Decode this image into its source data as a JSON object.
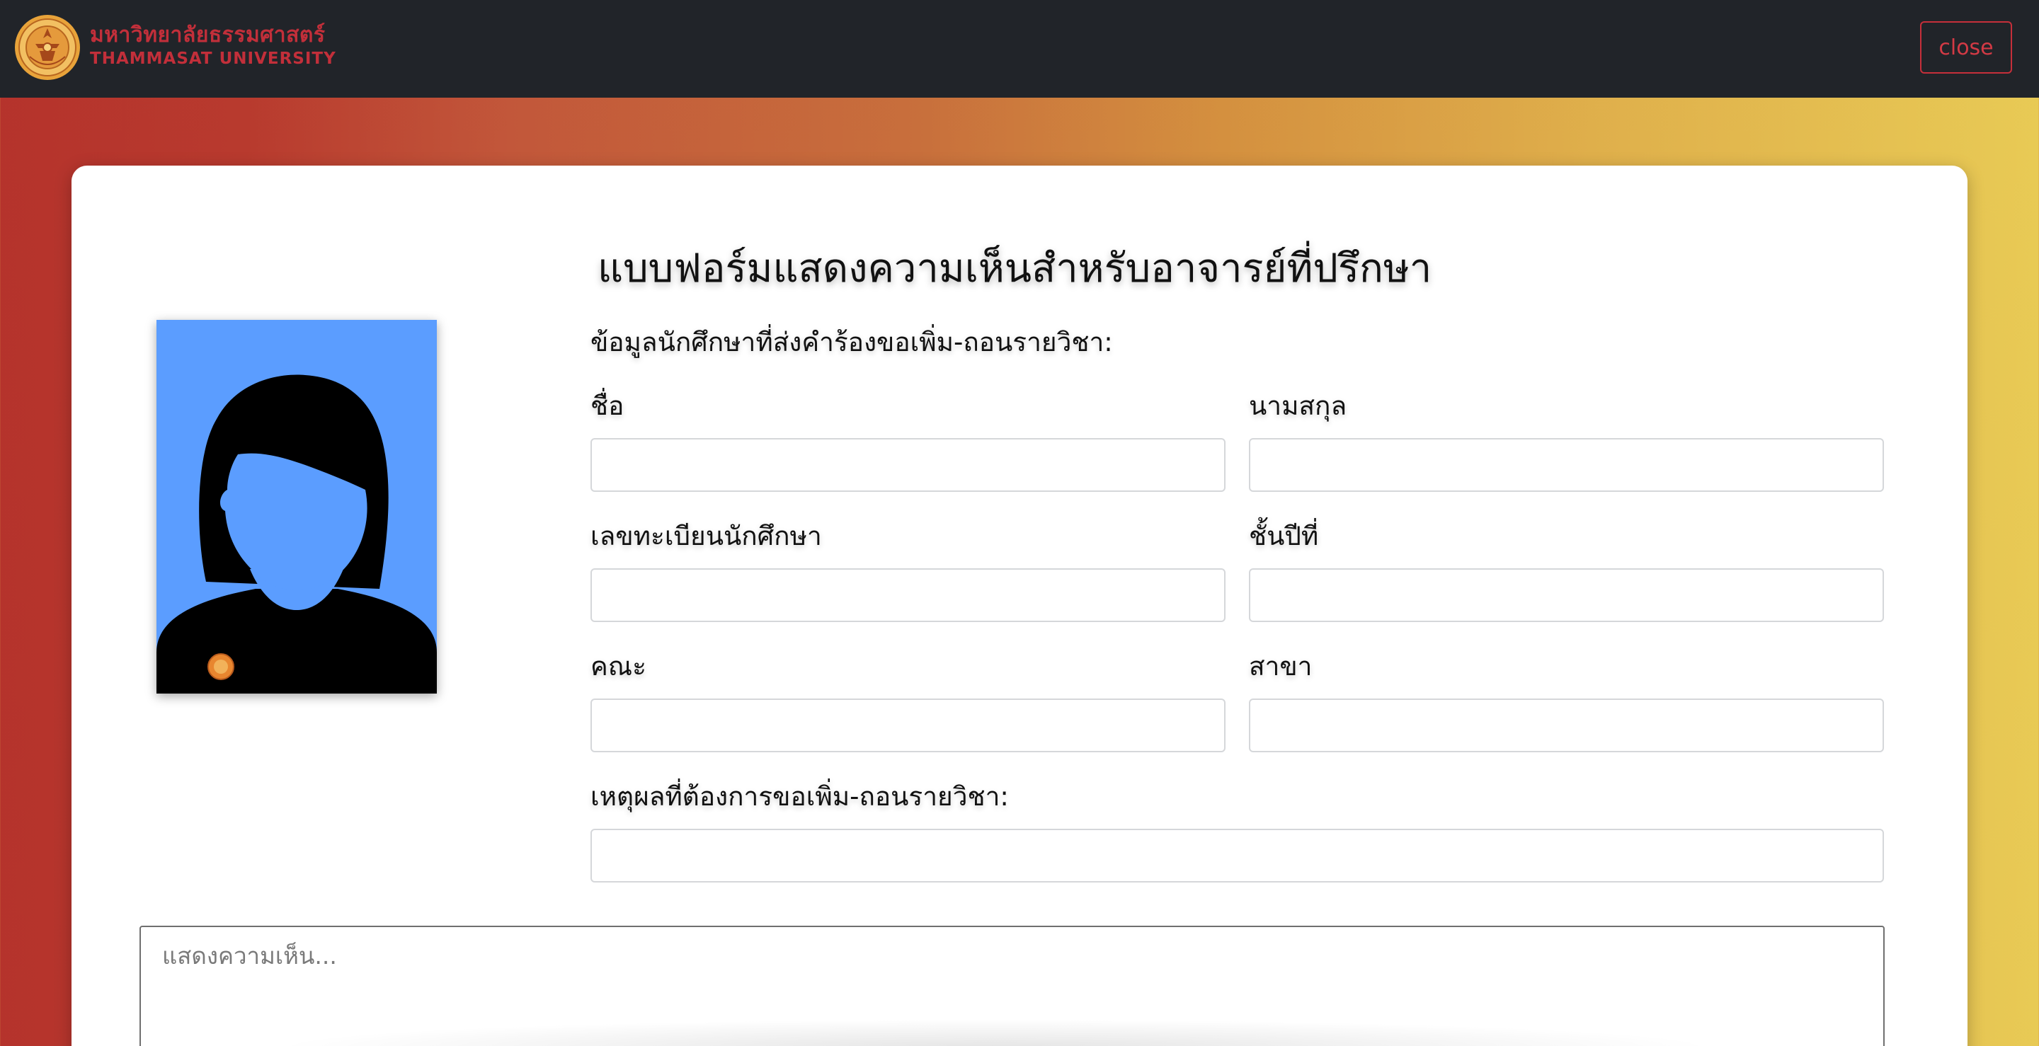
{
  "header": {
    "brand_th": "มหาวิทยาลัยธรรมศาสตร์",
    "brand_en": "THAMMASAT UNIVERSITY",
    "close_label": "close"
  },
  "form": {
    "title": "แบบฟอร์มแสดงความเห็นสำหรับอาจารย์ที่ปรึกษา",
    "subtitle": "ข้อมูลนักศึกษาที่ส่งคำร้องขอเพิ่ม-ถอนรายวิชา:",
    "first_name_label": "ชื่อ",
    "last_name_label": "นามสกุล",
    "student_id_label": "เลขทะเบียนนักศึกษา",
    "year_label": "ชั้นปีที่",
    "faculty_label": "คณะ",
    "major_label": "สาขา",
    "reason_label": "เหตุผลที่ต้องการขอเพิ่ม-ถอนรายวิชา:",
    "first_name_value": "",
    "last_name_value": "",
    "student_id_value": "",
    "year_value": "",
    "faculty_value": "",
    "major_value": "",
    "reason_value": "",
    "comment_placeholder": "แสดงความเห็น..."
  },
  "colors": {
    "topbar": "#212429",
    "brand_red": "#c22f3a",
    "photo_bg": "#5b9dff",
    "gradient_start": "#b5332c",
    "gradient_end": "#e8ca55"
  },
  "icons": {
    "logo": "thammasat-university-seal",
    "avatar": "female-avatar-placeholder"
  }
}
